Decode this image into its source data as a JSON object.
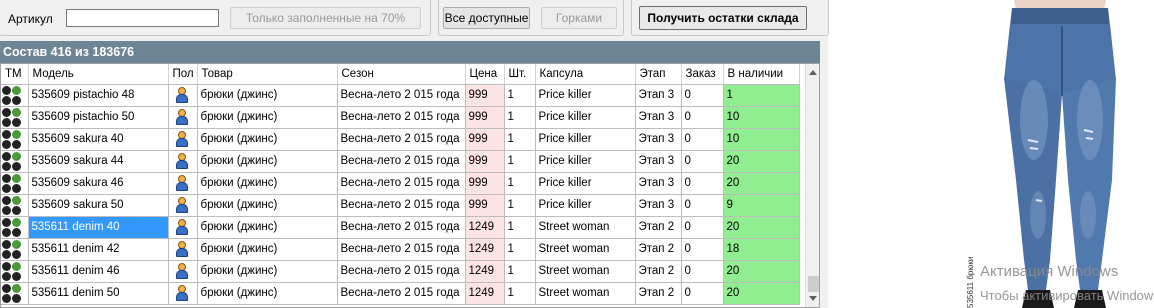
{
  "toolbar": {
    "article_label": "Артикул",
    "article_value": "",
    "filled_btn": "Только заполненные на 70%",
    "all_available_btn": "Все доступные",
    "gorki_btn": "Горками",
    "get_stock_btn": "Получить остатки склада"
  },
  "strip": {
    "title": "Состав 416 из 183676"
  },
  "columns": [
    "ТМ",
    "Модель",
    "Пол",
    "Товар",
    "Сезон",
    "Цена",
    "Шт.",
    "Капсула",
    "Этап",
    "Заказ",
    "В наличии"
  ],
  "rows": [
    {
      "model": "535609 pistachio  48",
      "product": "брюки (джинс)",
      "season": "Весна-лето 2 015 года",
      "price": "999",
      "qty": "1",
      "capsule": "Price killer",
      "stage": "Этап 3",
      "order": "0",
      "stock": "1"
    },
    {
      "model": "535609 pistachio  50",
      "product": "брюки (джинс)",
      "season": "Весна-лето 2 015 года",
      "price": "999",
      "qty": "1",
      "capsule": "Price killer",
      "stage": "Этап 3",
      "order": "0",
      "stock": "10"
    },
    {
      "model": "535609 sakura  40",
      "product": "брюки (джинс)",
      "season": "Весна-лето 2 015 года",
      "price": "999",
      "qty": "1",
      "capsule": "Price killer",
      "stage": "Этап 3",
      "order": "0",
      "stock": "10"
    },
    {
      "model": "535609 sakura  44",
      "product": "брюки (джинс)",
      "season": "Весна-лето 2 015 года",
      "price": "999",
      "qty": "1",
      "capsule": "Price killer",
      "stage": "Этап 3",
      "order": "0",
      "stock": "20"
    },
    {
      "model": "535609 sakura  46",
      "product": "брюки (джинс)",
      "season": "Весна-лето 2 015 года",
      "price": "999",
      "qty": "1",
      "capsule": "Price killer",
      "stage": "Этап 3",
      "order": "0",
      "stock": "20"
    },
    {
      "model": "535609 sakura  50",
      "product": "брюки (джинс)",
      "season": "Весна-лето 2 015 года",
      "price": "999",
      "qty": "1",
      "capsule": "Price killer",
      "stage": "Этап 3",
      "order": "0",
      "stock": "9"
    },
    {
      "model": "535611 denim  40",
      "product": "брюки (джинс)",
      "season": "Весна-лето 2 015 года",
      "price": "1249",
      "qty": "1",
      "capsule": "Street woman",
      "stage": "Этап 2",
      "order": "0",
      "stock": "20",
      "selected": true
    },
    {
      "model": "535611 denim  42",
      "product": "брюки (джинс)",
      "season": "Весна-лето 2 015 года",
      "price": "1249",
      "qty": "1",
      "capsule": "Street woman",
      "stage": "Этап 2",
      "order": "0",
      "stock": "18"
    },
    {
      "model": "535611 denim  46",
      "product": "брюки (джинс)",
      "season": "Весна-лето 2 015 года",
      "price": "1249",
      "qty": "1",
      "capsule": "Street woman",
      "stage": "Этап 2",
      "order": "0",
      "stock": "20"
    },
    {
      "model": "535611 denim  50",
      "product": "брюки (джинс)",
      "season": "Весна-лето 2 015 года",
      "price": "1249",
      "qty": "1",
      "capsule": "Street woman",
      "stage": "Этап 2",
      "order": "0",
      "stock": "20"
    }
  ],
  "product_panel": {
    "photo_caption": "535611 брюки",
    "watermark_line1": "Активация Windows",
    "watermark_line2": "Чтобы активировать Windows,"
  },
  "colors": {
    "strip": "#6e8596",
    "price_cell": "#fde4e4",
    "stock_cell": "#90ee90",
    "selection": "#3399ff",
    "denim": "#4a6e9e"
  }
}
